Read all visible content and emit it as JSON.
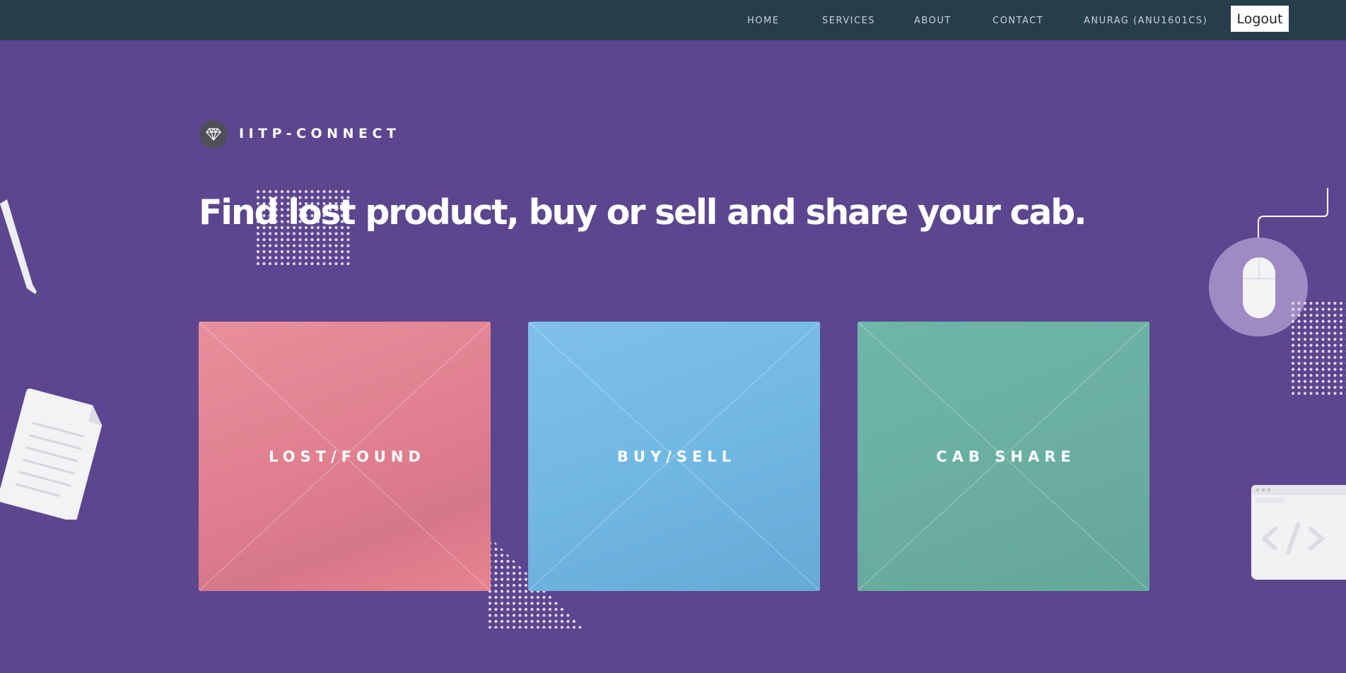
{
  "nav": {
    "items": [
      "HOME",
      "SERVICES",
      "ABOUT",
      "CONTACT",
      "ANURAG (ANU1601CS)"
    ],
    "logout_label": "Logout"
  },
  "brand": {
    "name": "IITP-CONNECT",
    "icon": "diamond-icon"
  },
  "hero": {
    "headline": "Find lost product, buy or sell and share your cab."
  },
  "tiles": [
    {
      "label": "LOST/FOUND",
      "color": "#e5858f"
    },
    {
      "label": "BUY/SELL",
      "color": "#72b8e3"
    },
    {
      "label": "CAB SHARE",
      "color": "#69afa2"
    }
  ],
  "decorations": [
    "pencil-icon",
    "document-icon",
    "mouse-icon",
    "code-window-icon"
  ],
  "colors": {
    "background": "#5c468f",
    "navbar": "#263d4c"
  }
}
